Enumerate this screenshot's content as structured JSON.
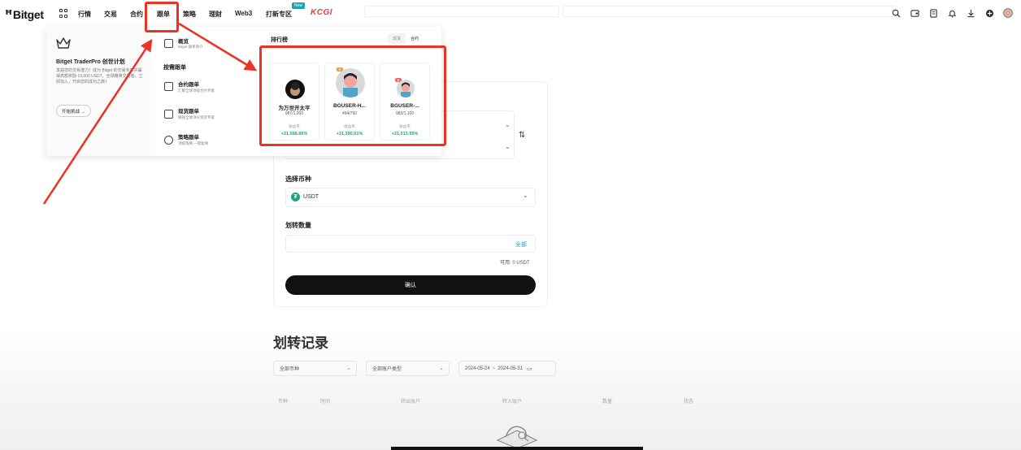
{
  "nav": {
    "logo": "Bitget",
    "items": [
      "行情",
      "交易",
      "合约",
      "跟单",
      "策略",
      "理财",
      "Web3",
      "打新专区"
    ],
    "new_badge": "New",
    "brand_tag": "KCGI"
  },
  "dropdown": {
    "promo": {
      "title": "Bitget TraderPro 创世计划",
      "desc": "发掘您的交易潜力！成为 Bitget 的交易专家并赢得高额奖励 10,000 USDT，全球精英交易者，立即加入，开启您的成功之旅！",
      "button": "开始挑战 →"
    },
    "overview": {
      "title": "概览",
      "sub": "Bitget 跟单简介"
    },
    "section_head": "按需跟单",
    "items": [
      {
        "title": "合约跟单",
        "sub": "汇聚全球顶级合约专家"
      },
      {
        "title": "现货跟单",
        "sub": "跟随全球顶尖现货专家"
      },
      {
        "title": "策略跟单",
        "sub": "顶级策略 一键复制"
      }
    ],
    "leaderboard": {
      "title": "排行榜",
      "tabs": [
        "现货",
        "合约"
      ],
      "active_tab": "合约",
      "profit_label": "收益率",
      "traders": [
        {
          "name": "为万世开太平",
          "followers": "987/1,000",
          "rate": "+31,568.86%"
        },
        {
          "name": "BGUSER-H...",
          "followers": "494/750",
          "rate": "+31,390.01%"
        },
        {
          "name": "BGUSER-...",
          "followers": "983/1,100",
          "rate": "+31,013.95%"
        }
      ]
    }
  },
  "form": {
    "coin_label": "选择币种",
    "coin_value": "USDT",
    "amount_label": "划转数量",
    "all_link": "全部",
    "available": "可用: 0 USDT",
    "confirm": "确认"
  },
  "records": {
    "title": "划转记录",
    "filters": [
      "全部币种",
      "全部账户类型"
    ],
    "date_from": "2024-05-24",
    "date_sep": "~",
    "date_to": "2024-05-31",
    "columns": [
      "币种",
      "时间",
      "转出账户",
      "转入账户",
      "数量",
      "状态"
    ]
  },
  "colors": {
    "annotation": "#ea3323",
    "accent": "#1da2b4",
    "profit": "#1aa87a",
    "brand_tag": "#e0413a"
  }
}
